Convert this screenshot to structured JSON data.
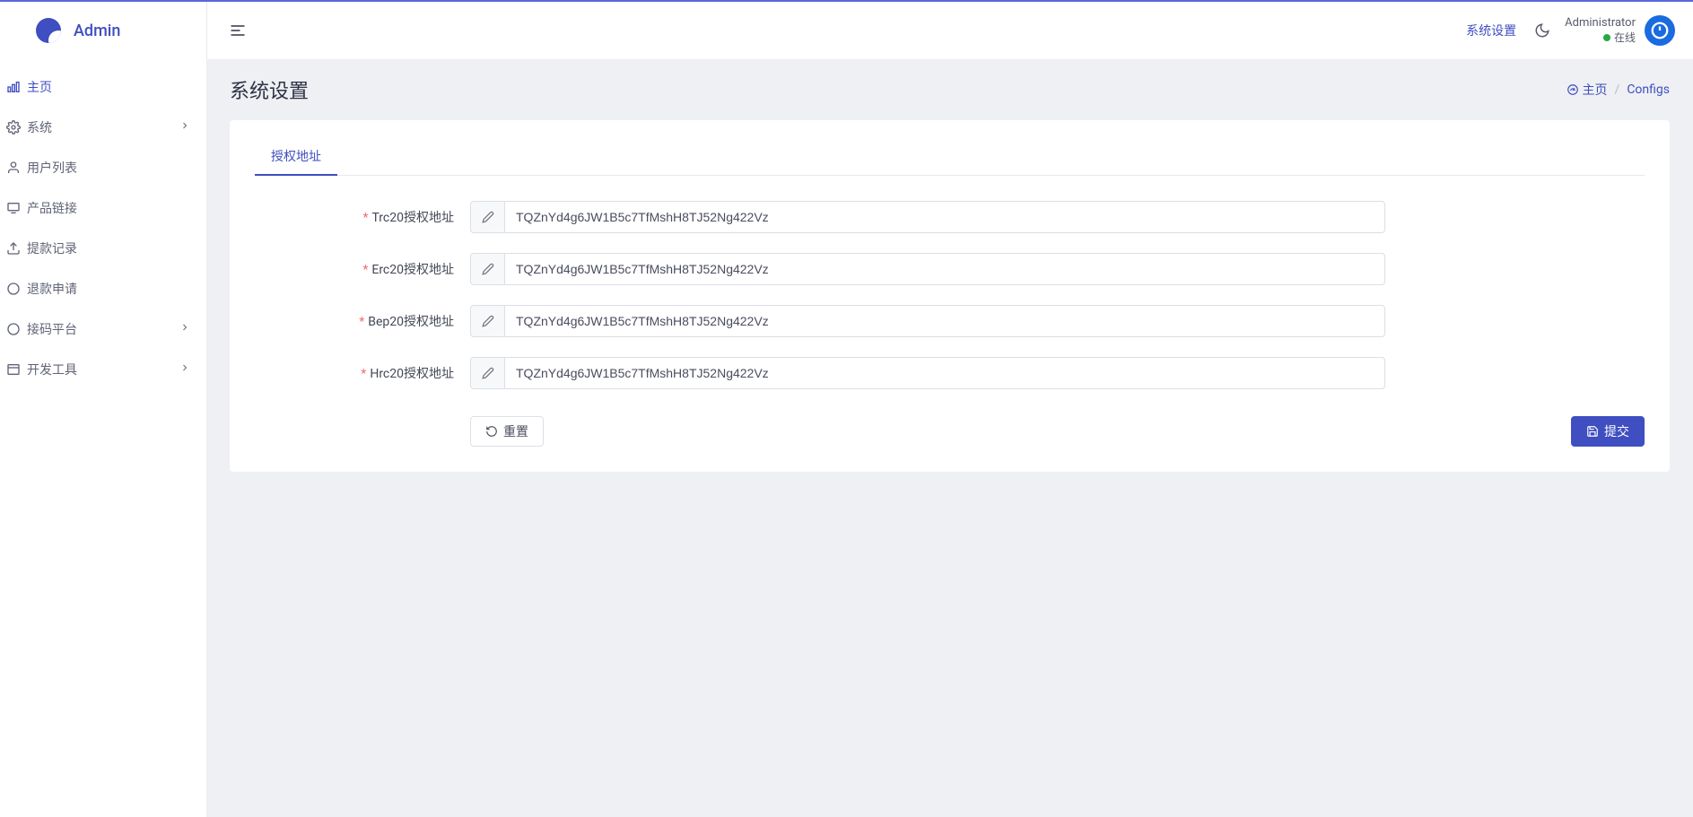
{
  "brand": {
    "name": "Admin"
  },
  "sidebar": {
    "items": [
      {
        "label": "主页",
        "icon": "chart-bar-icon",
        "hasChildren": false,
        "active": true
      },
      {
        "label": "系统",
        "icon": "gear-icon",
        "hasChildren": true
      },
      {
        "label": "用户列表",
        "icon": "user-icon",
        "hasChildren": false
      },
      {
        "label": "产品链接",
        "icon": "link-screen-icon",
        "hasChildren": false
      },
      {
        "label": "提款记录",
        "icon": "upload-icon",
        "hasChildren": false
      },
      {
        "label": "退款申请",
        "icon": "circle-icon",
        "hasChildren": false
      },
      {
        "label": "接码平台",
        "icon": "circle-icon",
        "hasChildren": true
      },
      {
        "label": "开发工具",
        "icon": "window-icon",
        "hasChildren": true
      }
    ]
  },
  "header": {
    "tab": "系统设置",
    "user_name": "Administrator",
    "status_text": "在线"
  },
  "page": {
    "title": "系统设置",
    "breadcrumb_home": "主页",
    "breadcrumb_current": "Configs"
  },
  "tabs": {
    "active": "授权地址"
  },
  "form": {
    "fields": [
      {
        "label": "Trc20授权地址",
        "value": "TQZnYd4g6JW1B5c7TfMshH8TJ52Ng422Vz"
      },
      {
        "label": "Erc20授权地址",
        "value": "TQZnYd4g6JW1B5c7TfMshH8TJ52Ng422Vz"
      },
      {
        "label": "Bep20授权地址",
        "value": "TQZnYd4g6JW1B5c7TfMshH8TJ52Ng422Vz"
      },
      {
        "label": "Hrc20授权地址",
        "value": "TQZnYd4g6JW1B5c7TfMshH8TJ52Ng422Vz"
      }
    ],
    "reset_label": "重置",
    "submit_label": "提交"
  }
}
